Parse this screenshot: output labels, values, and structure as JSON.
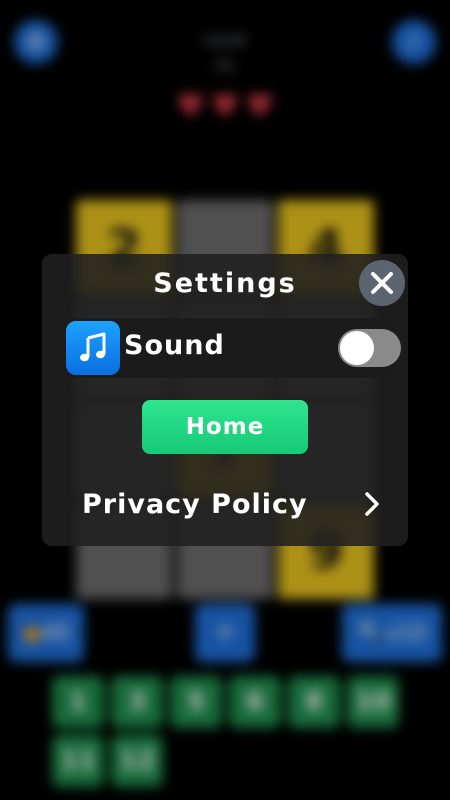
{
  "background": {
    "level_label": "Level",
    "level_number": "21",
    "lives": 3,
    "grid": [
      {
        "value": "2",
        "color": "yellow"
      },
      {
        "value": "",
        "color": "gray"
      },
      {
        "value": "4",
        "color": "yellow"
      },
      {
        "value": "",
        "color": "gray"
      },
      {
        "value": "",
        "color": "gray"
      },
      {
        "value": "",
        "color": "gray"
      },
      {
        "value": "",
        "color": "gray"
      },
      {
        "value": "7",
        "color": "yellow"
      },
      {
        "value": "",
        "color": "gray"
      },
      {
        "value": "",
        "color": "gray"
      },
      {
        "value": "",
        "color": "gray"
      },
      {
        "value": "9",
        "color": "yellow"
      }
    ],
    "coin_hint_cost": "40",
    "hint_cost": "x10",
    "number_choices": [
      "1",
      "3",
      "5",
      "6",
      "8",
      "10",
      "11",
      "12"
    ]
  },
  "settings": {
    "title": "Settings",
    "close_icon": "close-icon",
    "sound_label": "Sound",
    "sound_icon": "music-note-icon",
    "sound_enabled": false,
    "home_label": "Home",
    "privacy_label": "Privacy Policy",
    "chevron_icon": "chevron-right-icon"
  },
  "colors": {
    "home_button": "#2ee58e",
    "music_icon": "#1ea2ff",
    "close_button": "#5b6470",
    "toggle_off": "#8a8a8a"
  }
}
